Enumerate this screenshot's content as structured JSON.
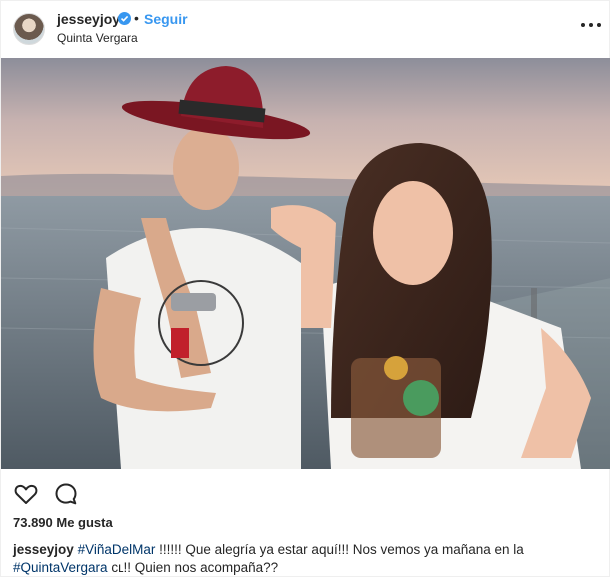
{
  "header": {
    "username": "jesseyjoy",
    "separator": "•",
    "follow_label": "Seguir",
    "location": "Quinta Vergara"
  },
  "icons": {
    "verified": "verified-badge-icon",
    "more": "more-options-icon",
    "like": "heart-icon",
    "comment": "comment-icon"
  },
  "likes": {
    "label": "73.890 Me gusta"
  },
  "caption": {
    "username": "jesseyjoy",
    "hashtag1": "#ViñaDelMar",
    "text1": " !!!!!! Que alegría ya estar aquí!!! Nos vemos ya mañana en la ",
    "hashtag2": "#QuintaVergara",
    "text2": " cʟ!! Quien nos acompaña??"
  },
  "colors": {
    "link_blue": "#3897f0",
    "hashtag_blue": "#003569",
    "text": "#262626"
  }
}
